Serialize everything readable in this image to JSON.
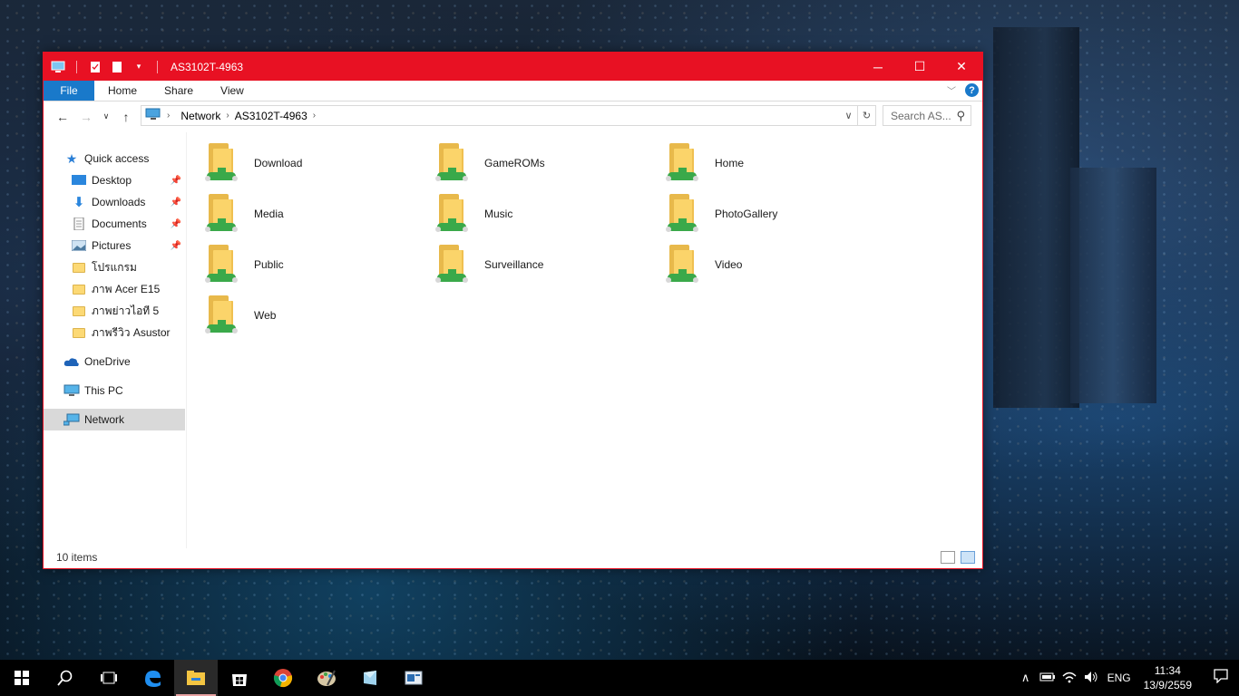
{
  "window": {
    "title": "AS3102T-4963",
    "accent": "#e81123",
    "controls": {
      "minimize": "─",
      "maximize": "☐",
      "close": "✕"
    }
  },
  "ribbon": {
    "tabs": [
      "File",
      "Home",
      "Share",
      "View"
    ],
    "help": "?"
  },
  "address": {
    "path": [
      "Network",
      "AS3102T-4963"
    ],
    "search_placeholder": "Search AS..."
  },
  "nav_pane": {
    "items": [
      {
        "label": "Quick access",
        "icon": "star-icon"
      },
      {
        "label": "Desktop",
        "icon": "desktop-icon",
        "pinned": true
      },
      {
        "label": "Downloads",
        "icon": "download-icon",
        "pinned": true
      },
      {
        "label": "Documents",
        "icon": "documents-icon",
        "pinned": true
      },
      {
        "label": "Pictures",
        "icon": "pictures-icon",
        "pinned": true
      },
      {
        "label": "โปรแกรม",
        "icon": "folder-icon"
      },
      {
        "label": "ภาพ Acer E15",
        "icon": "folder-icon"
      },
      {
        "label": "ภาพย่าวไอที 5",
        "icon": "folder-icon"
      },
      {
        "label": "ภาพรีวิว Asustor",
        "icon": "folder-icon"
      },
      {
        "label": "OneDrive",
        "icon": "cloud-icon"
      },
      {
        "label": "This PC",
        "icon": "computer-icon"
      },
      {
        "label": "Network",
        "icon": "network-icon",
        "selected": true
      }
    ]
  },
  "files": [
    "Download",
    "GameROMs",
    "Home",
    "Media",
    "Music",
    "PhotoGallery",
    "Public",
    "Surveillance",
    "Video",
    "Web"
  ],
  "status": {
    "count": "10 items"
  },
  "taskbar": {
    "tray": {
      "language": "ENG",
      "time": "11:34",
      "date": "13/9/2559"
    }
  }
}
